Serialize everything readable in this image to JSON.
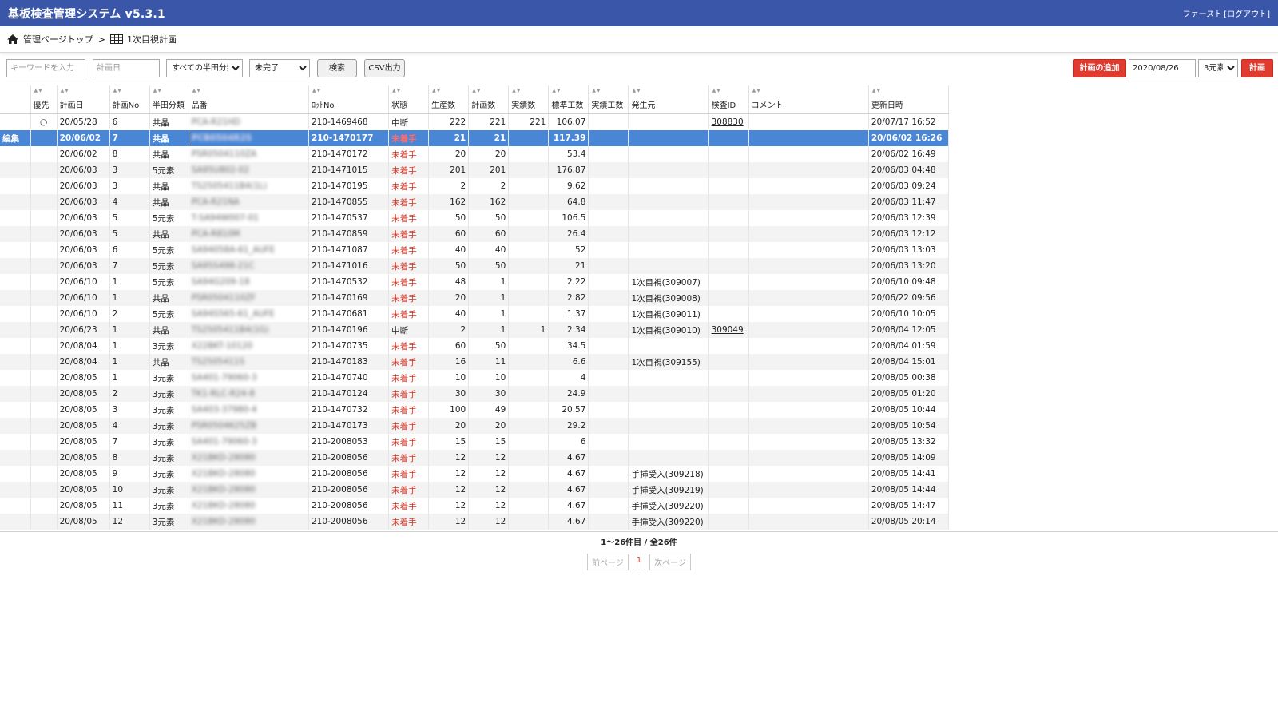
{
  "header": {
    "title": "基板検査管理システム v5.3.1",
    "user": "ファースト",
    "logout": "[ログアウト]"
  },
  "breadcrumb": {
    "home": "管理ページトップ",
    "separator": ">",
    "current": "1次目視計画"
  },
  "toolbar": {
    "keyword_placeholder": "キーワードを入力",
    "date_placeholder": "計画日",
    "category_select": "すべての半田分類",
    "status_select": "未完了",
    "search_label": "検索",
    "csv_label": "CSV出力",
    "add_plan_label": "計画の追加",
    "date_value": "2020/08/26",
    "element_select": "3元素",
    "plan_label": "計画"
  },
  "table": {
    "columns": [
      "",
      "優先",
      "計画日",
      "計画No",
      "半田分類",
      "品番",
      "ﾛｯﾄNo",
      "状態",
      "生産数",
      "計画数",
      "実績数",
      "標準工数",
      "実績工数",
      "発生元",
      "検査ID",
      "コメント",
      "更新日時"
    ],
    "rows": [
      {
        "action": "",
        "pri": "○",
        "date": "20/05/28",
        "no": "6",
        "cat": "共晶",
        "part": "PCA-R21HD",
        "lot": "210-1469468",
        "status": "中断",
        "prod": "222",
        "plan": "221",
        "actual": "221",
        "std": "106.07",
        "act_hours": "",
        "src": "",
        "insp": "308830",
        "comment": "",
        "updated": "20/07/17 16:52"
      },
      {
        "action": "編集",
        "pri": "",
        "date": "20/06/02",
        "no": "7",
        "cat": "共晶",
        "part": "PCB0504R2S",
        "lot": "210-1470177",
        "status": "未着手",
        "prod": "21",
        "plan": "21",
        "actual": "",
        "std": "117.39",
        "act_hours": "",
        "src": "",
        "insp": "",
        "comment": "",
        "updated": "20/06/02 16:26"
      },
      {
        "action": "",
        "pri": "",
        "date": "20/06/02",
        "no": "8",
        "cat": "共晶",
        "part": "PSR0504110ZA",
        "lot": "210-1470172",
        "status": "未着手",
        "prod": "20",
        "plan": "20",
        "actual": "",
        "std": "53.4",
        "act_hours": "",
        "src": "",
        "insp": "",
        "comment": "",
        "updated": "20/06/02 16:49"
      },
      {
        "action": "",
        "pri": "",
        "date": "20/06/03",
        "no": "3",
        "cat": "5元素",
        "part": "SA95U802-02",
        "lot": "210-1471015",
        "status": "未着手",
        "prod": "201",
        "plan": "201",
        "actual": "",
        "std": "176.87",
        "act_hours": "",
        "src": "",
        "insp": "",
        "comment": "",
        "updated": "20/06/03 04:48"
      },
      {
        "action": "",
        "pri": "",
        "date": "20/06/03",
        "no": "3",
        "cat": "共晶",
        "part": "TS2505411B4(1L)",
        "lot": "210-1470195",
        "status": "未着手",
        "prod": "2",
        "plan": "2",
        "actual": "",
        "std": "9.62",
        "act_hours": "",
        "src": "",
        "insp": "",
        "comment": "",
        "updated": "20/06/03 09:24"
      },
      {
        "action": "",
        "pri": "",
        "date": "20/06/03",
        "no": "4",
        "cat": "共晶",
        "part": "PCA-R21NA",
        "lot": "210-1470855",
        "status": "未着手",
        "prod": "162",
        "plan": "162",
        "actual": "",
        "std": "64.8",
        "act_hours": "",
        "src": "",
        "insp": "",
        "comment": "",
        "updated": "20/06/03 11:47"
      },
      {
        "action": "",
        "pri": "",
        "date": "20/06/03",
        "no": "5",
        "cat": "5元素",
        "part": "T-SA94W007-01",
        "lot": "210-1470537",
        "status": "未着手",
        "prod": "50",
        "plan": "50",
        "actual": "",
        "std": "106.5",
        "act_hours": "",
        "src": "",
        "insp": "",
        "comment": "",
        "updated": "20/06/03 12:39"
      },
      {
        "action": "",
        "pri": "",
        "date": "20/06/03",
        "no": "5",
        "cat": "共晶",
        "part": "PCA-R810M",
        "lot": "210-1470859",
        "status": "未着手",
        "prod": "60",
        "plan": "60",
        "actual": "",
        "std": "26.4",
        "act_hours": "",
        "src": "",
        "insp": "",
        "comment": "",
        "updated": "20/06/03 12:12"
      },
      {
        "action": "",
        "pri": "",
        "date": "20/06/03",
        "no": "6",
        "cat": "5元素",
        "part": "SA94058A-61_AUFE",
        "lot": "210-1471087",
        "status": "未着手",
        "prod": "40",
        "plan": "40",
        "actual": "",
        "std": "52",
        "act_hours": "",
        "src": "",
        "insp": "",
        "comment": "",
        "updated": "20/06/03 13:03"
      },
      {
        "action": "",
        "pri": "",
        "date": "20/06/03",
        "no": "7",
        "cat": "5元素",
        "part": "SA95S498-21C",
        "lot": "210-1471016",
        "status": "未着手",
        "prod": "50",
        "plan": "50",
        "actual": "",
        "std": "21",
        "act_hours": "",
        "src": "",
        "insp": "",
        "comment": "",
        "updated": "20/06/03 13:20"
      },
      {
        "action": "",
        "pri": "",
        "date": "20/06/10",
        "no": "1",
        "cat": "5元素",
        "part": "SA94G209-18",
        "lot": "210-1470532",
        "status": "未着手",
        "prod": "48",
        "plan": "1",
        "actual": "",
        "std": "2.22",
        "act_hours": "",
        "src": "1次目視(309007)",
        "insp": "",
        "comment": "",
        "updated": "20/06/10 09:48"
      },
      {
        "action": "",
        "pri": "",
        "date": "20/06/10",
        "no": "1",
        "cat": "共晶",
        "part": "PSR0504110ZF",
        "lot": "210-1470169",
        "status": "未着手",
        "prod": "20",
        "plan": "1",
        "actual": "",
        "std": "2.82",
        "act_hours": "",
        "src": "1次目視(309008)",
        "insp": "",
        "comment": "",
        "updated": "20/06/22 09:56"
      },
      {
        "action": "",
        "pri": "",
        "date": "20/06/10",
        "no": "2",
        "cat": "5元素",
        "part": "SA94S565-61_AUFE",
        "lot": "210-1470681",
        "status": "未着手",
        "prod": "40",
        "plan": "1",
        "actual": "",
        "std": "1.37",
        "act_hours": "",
        "src": "1次目視(309011)",
        "insp": "",
        "comment": "",
        "updated": "20/06/10 10:05"
      },
      {
        "action": "",
        "pri": "",
        "date": "20/06/23",
        "no": "1",
        "cat": "共晶",
        "part": "TS2505411B4(1G)",
        "lot": "210-1470196",
        "status": "中断",
        "prod": "2",
        "plan": "1",
        "actual": "1",
        "std": "2.34",
        "act_hours": "",
        "src": "1次目視(309010)",
        "insp": "309049",
        "comment": "",
        "updated": "20/08/04 12:05"
      },
      {
        "action": "",
        "pri": "",
        "date": "20/08/04",
        "no": "1",
        "cat": "3元素",
        "part": "X22BKT-10120",
        "lot": "210-1470735",
        "status": "未着手",
        "prod": "60",
        "plan": "50",
        "actual": "",
        "std": "34.5",
        "act_hours": "",
        "src": "",
        "insp": "",
        "comment": "",
        "updated": "20/08/04 01:59"
      },
      {
        "action": "",
        "pri": "",
        "date": "20/08/04",
        "no": "1",
        "cat": "共晶",
        "part": "TS2505411S",
        "lot": "210-1470183",
        "status": "未着手",
        "prod": "16",
        "plan": "11",
        "actual": "",
        "std": "6.6",
        "act_hours": "",
        "src": "1次目視(309155)",
        "insp": "",
        "comment": "",
        "updated": "20/08/04 15:01"
      },
      {
        "action": "",
        "pri": "",
        "date": "20/08/05",
        "no": "1",
        "cat": "3元素",
        "part": "SA401-79060-3",
        "lot": "210-1470740",
        "status": "未着手",
        "prod": "10",
        "plan": "10",
        "actual": "",
        "std": "4",
        "act_hours": "",
        "src": "",
        "insp": "",
        "comment": "",
        "updated": "20/08/05 00:38"
      },
      {
        "action": "",
        "pri": "",
        "date": "20/08/05",
        "no": "2",
        "cat": "3元素",
        "part": "TK1-RLC-R24-8",
        "lot": "210-1470124",
        "status": "未着手",
        "prod": "30",
        "plan": "30",
        "actual": "",
        "std": "24.9",
        "act_hours": "",
        "src": "",
        "insp": "",
        "comment": "",
        "updated": "20/08/05 01:20"
      },
      {
        "action": "",
        "pri": "",
        "date": "20/08/05",
        "no": "3",
        "cat": "3元素",
        "part": "SA403-37980-4",
        "lot": "210-1470732",
        "status": "未着手",
        "prod": "100",
        "plan": "49",
        "actual": "",
        "std": "20.57",
        "act_hours": "",
        "src": "",
        "insp": "",
        "comment": "",
        "updated": "20/08/05 10:44"
      },
      {
        "action": "",
        "pri": "",
        "date": "20/08/05",
        "no": "4",
        "cat": "3元素",
        "part": "PSR0504625ZB",
        "lot": "210-1470173",
        "status": "未着手",
        "prod": "20",
        "plan": "20",
        "actual": "",
        "std": "29.2",
        "act_hours": "",
        "src": "",
        "insp": "",
        "comment": "",
        "updated": "20/08/05 10:54"
      },
      {
        "action": "",
        "pri": "",
        "date": "20/08/05",
        "no": "7",
        "cat": "3元素",
        "part": "SA401-79060-3",
        "lot": "210-2008053",
        "status": "未着手",
        "prod": "15",
        "plan": "15",
        "actual": "",
        "std": "6",
        "act_hours": "",
        "src": "",
        "insp": "",
        "comment": "",
        "updated": "20/08/05 13:32"
      },
      {
        "action": "",
        "pri": "",
        "date": "20/08/05",
        "no": "8",
        "cat": "3元素",
        "part": "X21BKD-28080",
        "lot": "210-2008056",
        "status": "未着手",
        "prod": "12",
        "plan": "12",
        "actual": "",
        "std": "4.67",
        "act_hours": "",
        "src": "",
        "insp": "",
        "comment": "",
        "updated": "20/08/05 14:09"
      },
      {
        "action": "",
        "pri": "",
        "date": "20/08/05",
        "no": "9",
        "cat": "3元素",
        "part": "X21BKD-28080",
        "lot": "210-2008056",
        "status": "未着手",
        "prod": "12",
        "plan": "12",
        "actual": "",
        "std": "4.67",
        "act_hours": "",
        "src": "手挿受入(309218)",
        "insp": "",
        "comment": "",
        "updated": "20/08/05 14:41"
      },
      {
        "action": "",
        "pri": "",
        "date": "20/08/05",
        "no": "10",
        "cat": "3元素",
        "part": "X21BKD-28080",
        "lot": "210-2008056",
        "status": "未着手",
        "prod": "12",
        "plan": "12",
        "actual": "",
        "std": "4.67",
        "act_hours": "",
        "src": "手挿受入(309219)",
        "insp": "",
        "comment": "",
        "updated": "20/08/05 14:44"
      },
      {
        "action": "",
        "pri": "",
        "date": "20/08/05",
        "no": "11",
        "cat": "3元素",
        "part": "X21BKD-28080",
        "lot": "210-2008056",
        "status": "未着手",
        "prod": "12",
        "plan": "12",
        "actual": "",
        "std": "4.67",
        "act_hours": "",
        "src": "手挿受入(309220)",
        "insp": "",
        "comment": "",
        "updated": "20/08/05 14:47"
      },
      {
        "action": "",
        "pri": "",
        "date": "20/08/05",
        "no": "12",
        "cat": "3元素",
        "part": "X21BKD-28080",
        "lot": "210-2008056",
        "status": "未着手",
        "prod": "12",
        "plan": "12",
        "actual": "",
        "std": "4.67",
        "act_hours": "",
        "src": "手挿受入(309220)",
        "insp": "",
        "comment": "",
        "updated": "20/08/05 20:14"
      }
    ]
  },
  "pagination": {
    "summary": "1～26件目 / 全26件",
    "prev": "前ページ",
    "current": "1",
    "next": "次ページ"
  },
  "colors": {
    "header_bg": "#3a56a8",
    "selected_row": "#4a86d6",
    "accent_red": "#e03b2e",
    "status_red": "#d23020"
  }
}
